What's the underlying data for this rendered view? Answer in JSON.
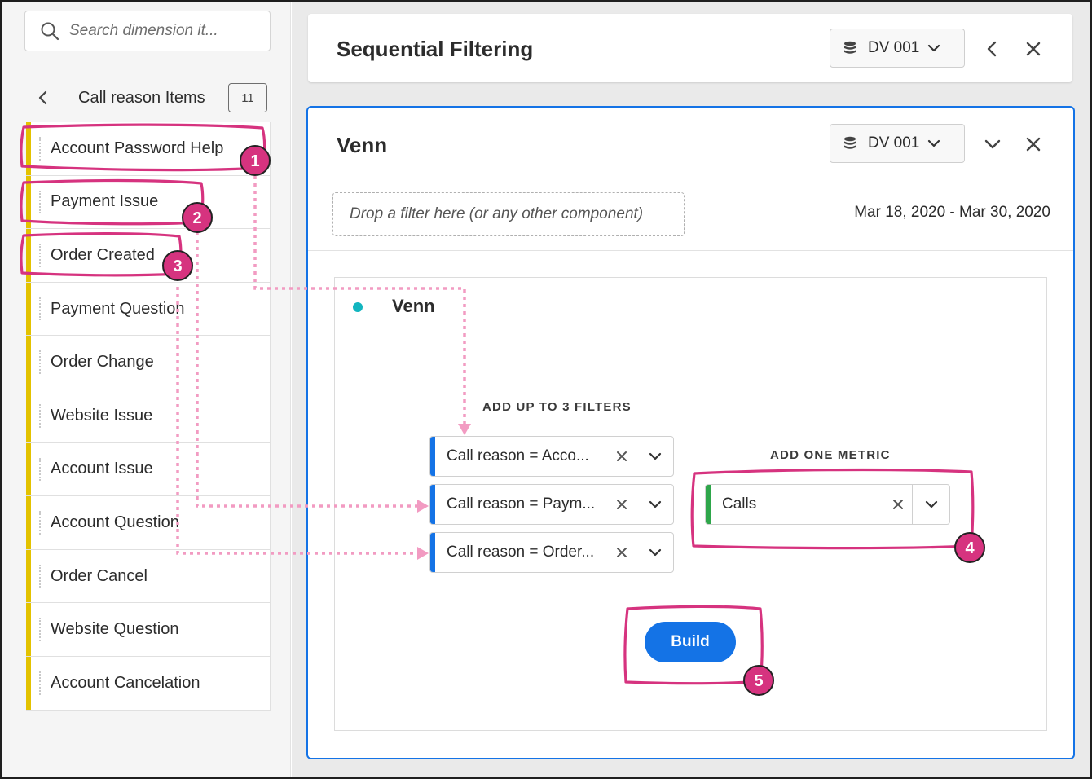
{
  "search": {
    "placeholder": "Search dimension it..."
  },
  "breadcrumb": {
    "label": "Call reason Items",
    "count": "11"
  },
  "items": [
    "Account Password Help",
    "Payment Issue",
    "Order Created",
    "Payment Question",
    "Order Change",
    "Website Issue",
    "Account Issue",
    "Account Question",
    "Order Cancel",
    "Website Question",
    "Account Cancelation"
  ],
  "panel_outer": {
    "title": "Sequential Filtering",
    "dataview": "DV 001"
  },
  "panel_venn": {
    "title": "Venn",
    "dataview": "DV 001",
    "dropzone": "Drop a filter here (or any other component)",
    "date_range": "Mar 18, 2020 - Mar 30, 2020",
    "viz_title": "Venn",
    "filters_label": "ADD UP TO 3 FILTERS",
    "filters": [
      "Call reason = Acco...",
      "Call reason = Paym...",
      "Call reason = Order..."
    ],
    "metric_label": "ADD ONE METRIC",
    "metric": "Calls",
    "build_label": "Build"
  },
  "annotations": [
    "1",
    "2",
    "3",
    "4",
    "5"
  ],
  "colors": {
    "accent": "#1473e6",
    "item_bar": "#e3c200",
    "metric_bar": "#2ea64a",
    "annotation": "#d6337f",
    "viz_dot": "#12b5bf"
  }
}
